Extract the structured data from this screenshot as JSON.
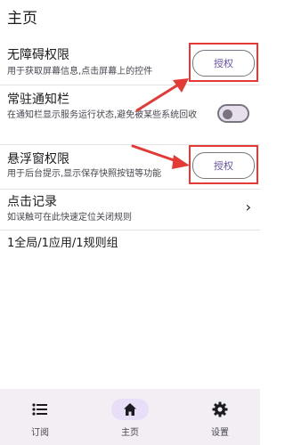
{
  "page": {
    "title": "主页"
  },
  "accessibility": {
    "title": "无障碍权限",
    "desc": "用于获取屏幕信息,点击屏幕上的控件",
    "button": "授权"
  },
  "notification": {
    "title": "常驻通知栏",
    "desc": "在通知栏显示服务运行状态,避免被某些系统回收",
    "toggle_on": false
  },
  "floating": {
    "title": "悬浮窗权限",
    "desc": "用于后台提示,显示保存快照按钮等功能",
    "button": "授权"
  },
  "click_record": {
    "title": "点击记录",
    "desc": "如误触可在此快速定位关闭规则"
  },
  "summary": "1全局/1应用/1规则组",
  "nav": {
    "items": [
      {
        "label": "订阅",
        "icon": "list-icon"
      },
      {
        "label": "主页",
        "icon": "home-icon",
        "active": true
      },
      {
        "label": "设置",
        "icon": "gear-icon"
      }
    ]
  },
  "colors": {
    "highlight": "#e53935",
    "accent": "#6750a4",
    "nav_active": "#e8def8"
  }
}
